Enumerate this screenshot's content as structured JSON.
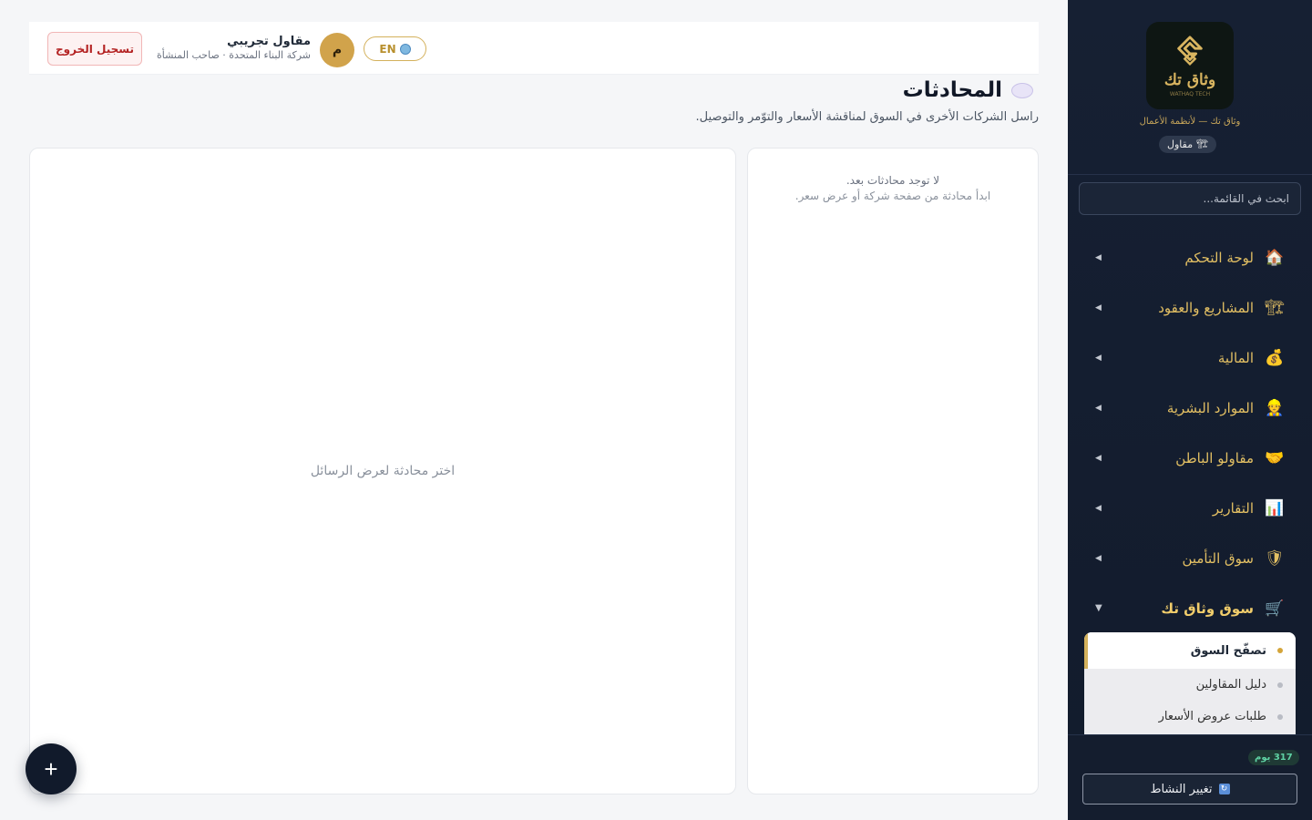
{
  "sidebar": {
    "logo_text": "وثاق تك",
    "logo_sub": "WATHAQ TECH",
    "tagline": "وثاق تك — لأنظمة الأعمال",
    "role_badge": "مقاول",
    "search_placeholder": "ابحث في القائمة...",
    "nav": [
      {
        "label": "لوحة التحكم",
        "icon": "home-icon",
        "glyph": "🏠"
      },
      {
        "label": "المشاريع والعقود",
        "icon": "crane-icon",
        "glyph": "🏗"
      },
      {
        "label": "المالية",
        "icon": "money-bag-icon",
        "glyph": "💰"
      },
      {
        "label": "الموارد البشرية",
        "icon": "person-icon",
        "glyph": "👷"
      },
      {
        "label": "مقاولو الباطن",
        "icon": "handshake-icon",
        "glyph": "🤝"
      },
      {
        "label": "التقارير",
        "icon": "chart-icon",
        "glyph": "📊"
      },
      {
        "label": "سوق التأمين",
        "icon": "shield-icon",
        "glyph": "🛡"
      },
      {
        "label": "سوق وثاق تك",
        "icon": "cart-icon",
        "glyph": "🛒"
      }
    ],
    "submenu": [
      {
        "label": "تصفّح السوق"
      },
      {
        "label": "دليل المقاولين"
      },
      {
        "label": "طلبات عروض الأسعار"
      }
    ],
    "days_badge": "317 يوم",
    "switch_label": "تغيير النشاط"
  },
  "topbar": {
    "lang": "EN",
    "avatar_initial": "م",
    "user_name": "مقاول تجريبي",
    "user_sub": "شركة البناء المتحدة · صاحب المنشأة",
    "logout": "تسجيل الخروج"
  },
  "page": {
    "title": "المحادثات",
    "subtitle": "راسل الشركات الأخرى في السوق لمناقشة الأسعار والتوّمر والتوصيل."
  },
  "conversations": {
    "empty_title": "لا توجد محادثات بعد.",
    "empty_sub": "ابدأ محادثة من صفحة شركة أو عرض سعر."
  },
  "messages": {
    "hint": "اختر محادثة لعرض الرسائل"
  },
  "fab": {
    "label": "+"
  },
  "colors": {
    "sidebar_bg": "#162033",
    "accent_gold": "#e2bf63",
    "danger": "#b42323",
    "success": "#5fd2a4"
  }
}
